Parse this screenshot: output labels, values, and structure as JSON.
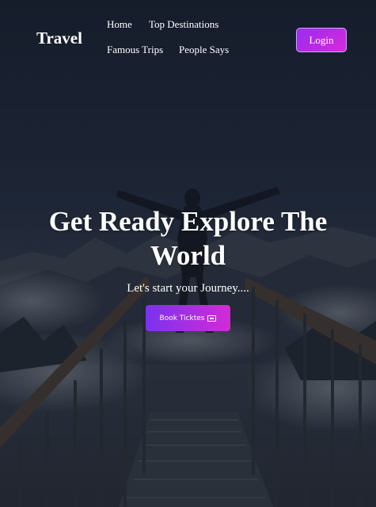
{
  "brand": {
    "logo": "Travel"
  },
  "nav": {
    "items": [
      {
        "label": "Home"
      },
      {
        "label": "Top Destinations"
      },
      {
        "label": "Famous Trips"
      },
      {
        "label": "People Says"
      }
    ],
    "login_label": "Login"
  },
  "hero": {
    "title": "Get Ready Explore The World",
    "subtitle": "Let's start your Journey....",
    "cta_label": "Book Ticktes",
    "cta_icon": "ticket-icon",
    "background": "person-on-mountain-bridge-photo"
  },
  "colors": {
    "accent_start": "#7b32ef",
    "accent_end": "#d22bd6",
    "overlay": "#1b2232"
  }
}
